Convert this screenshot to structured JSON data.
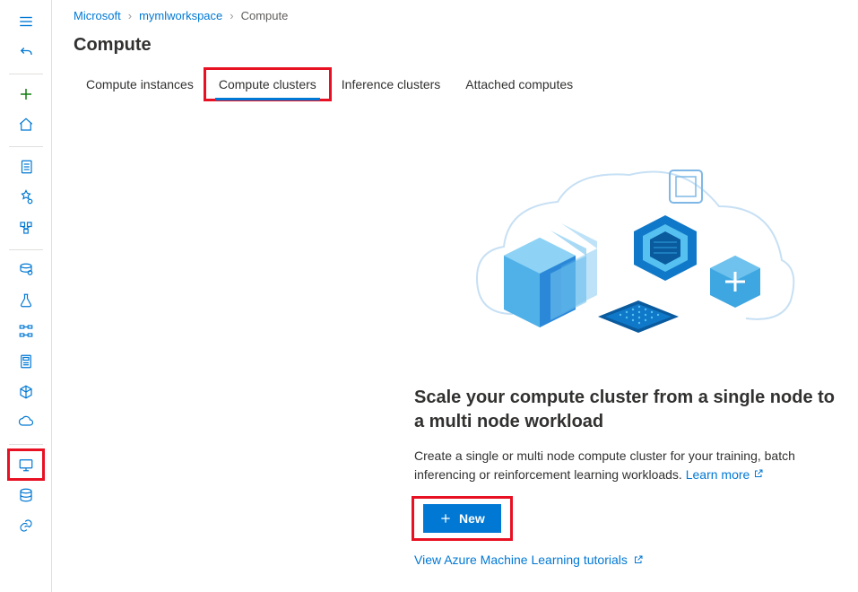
{
  "breadcrumb": {
    "org": "Microsoft",
    "workspace": "mymlworkspace",
    "current": "Compute"
  },
  "page_title": "Compute",
  "tabs": {
    "instances": "Compute instances",
    "clusters": "Compute clusters",
    "inference": "Inference clusters",
    "attached": "Attached computes"
  },
  "empty_state": {
    "title": "Scale your compute cluster from a single node to a multi node workload",
    "description": "Create a single or multi node compute cluster for your training, batch inferencing or reinforcement learning workloads. ",
    "learn_more": "Learn more",
    "new_button": "New",
    "tutorials_link": "View Azure Machine Learning tutorials"
  },
  "sidebar": {
    "menu": "menu",
    "back": "back",
    "new": "new",
    "home": "home",
    "notebooks": "notebooks",
    "automl": "automl",
    "designer": "designer",
    "datasets": "datasets",
    "experiments": "experiments",
    "pipelines": "pipelines",
    "models": "models",
    "endpoints": "endpoints",
    "environments": "environments",
    "compute": "compute",
    "datastores": "datastores",
    "linked": "linked"
  }
}
